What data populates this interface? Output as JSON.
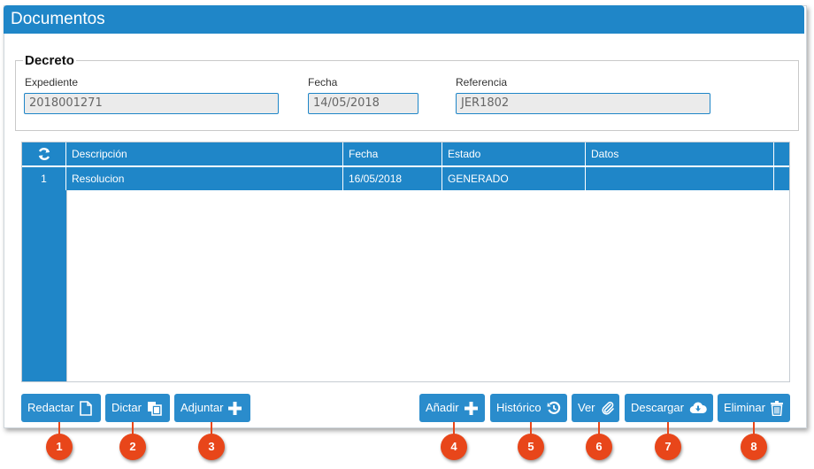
{
  "window": {
    "title": "Documentos"
  },
  "decreto": {
    "legend": "Decreto",
    "fields": [
      {
        "label": "Expediente",
        "value": "2018001271"
      },
      {
        "label": "Fecha",
        "value": "14/05/2018"
      },
      {
        "label": "Referencia",
        "value": "JER1802"
      }
    ]
  },
  "grid": {
    "refresh_icon": "refresh-icon",
    "columns": [
      "Descripción",
      "Fecha",
      "Estado",
      "Datos"
    ],
    "rows": [
      {
        "num": "1",
        "descripcion": "Resolucion",
        "fecha": "16/05/2018",
        "estado": "GENERADO",
        "datos": ""
      }
    ]
  },
  "buttons": [
    {
      "label": "Redactar",
      "icon": "file-icon",
      "badge": "1"
    },
    {
      "label": "Dictar",
      "icon": "copy-icon",
      "badge": "2"
    },
    {
      "label": "Adjuntar",
      "icon": "plus-icon",
      "badge": "3"
    },
    {
      "label": "Añadir",
      "icon": "plus-icon",
      "badge": "4"
    },
    {
      "label": "Histórico",
      "icon": "history-icon",
      "badge": "5"
    },
    {
      "label": "Ver",
      "icon": "paperclip-icon",
      "badge": "6"
    },
    {
      "label": "Descargar",
      "icon": "cloud-download-icon",
      "badge": "7"
    },
    {
      "label": "Eliminar",
      "icon": "trash-icon",
      "badge": "8"
    }
  ],
  "colors": {
    "primary": "#1f86c8",
    "badge": "#e8461a"
  }
}
